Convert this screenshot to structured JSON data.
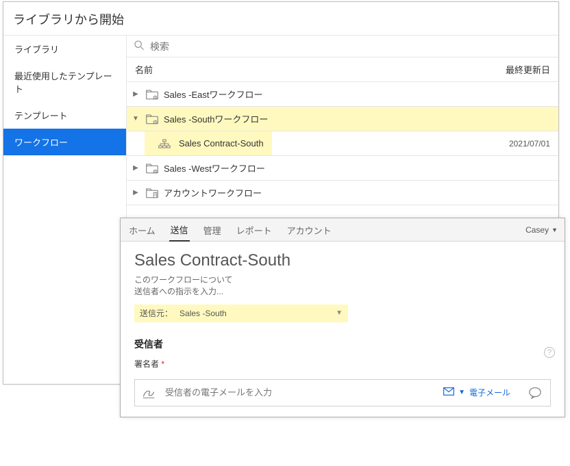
{
  "dialog": {
    "title": "ライブラリから開始",
    "sidebar": {
      "items": [
        {
          "label": "ライブラリ"
        },
        {
          "label": "最近使用したテンプレート"
        },
        {
          "label": "テンプレート"
        },
        {
          "label": "ワークフロー"
        }
      ],
      "selected_index": 3
    },
    "search": {
      "placeholder": "検索"
    },
    "columns": {
      "name": "名前",
      "updated": "最終更新日"
    },
    "rows": [
      {
        "type": "group",
        "label": "Sales -Eastワークフロー",
        "expanded": false,
        "highlight": false
      },
      {
        "type": "group",
        "label": "Sales -Southワークフロー",
        "expanded": true,
        "highlight": true
      },
      {
        "type": "item",
        "label": "Sales Contract-South",
        "date": "2021/07/01",
        "highlight": true
      },
      {
        "type": "group",
        "label": "Sales -Westワークフロー",
        "expanded": false,
        "highlight": false
      },
      {
        "type": "group",
        "label": "アカウントワークフロー",
        "expanded": false,
        "highlight": false
      }
    ]
  },
  "window2": {
    "tabs": [
      "ホーム",
      "送信",
      "管理",
      "レポート",
      "アカウント"
    ],
    "active_tab_index": 1,
    "user": "Casey",
    "title": "Sales Contract-South",
    "desc_line1": "このワークフローについて",
    "desc_line2": "送信者への指示を入力...",
    "send_from_label": "送信元：",
    "send_from_value": "Sales -South",
    "recipients_heading": "受信者",
    "signer_label": "署名者",
    "required_marker": "*",
    "email_placeholder": "受信者の電子メールを入力",
    "method_label": "電子メール"
  }
}
